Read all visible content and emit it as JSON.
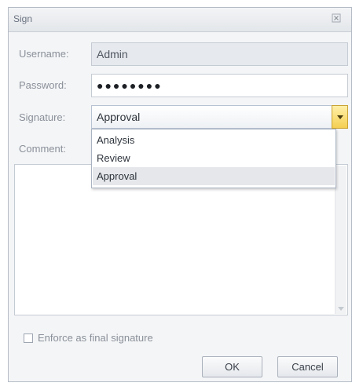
{
  "dialog": {
    "title": "Sign"
  },
  "form": {
    "username_label": "Username:",
    "username_value": "Admin",
    "password_label": "Password:",
    "password_value": "●●●●●●●●",
    "signature_label": "Signature:",
    "signature_value": "Approval",
    "comment_label": "Comment:",
    "comment_value": ""
  },
  "signature_options": [
    {
      "label": "Analysis",
      "selected": false
    },
    {
      "label": "Review",
      "selected": false
    },
    {
      "label": "Approval",
      "selected": true
    }
  ],
  "enforce_checkbox": {
    "label": "Enforce as final signature",
    "checked": false
  },
  "buttons": {
    "ok": "OK",
    "cancel": "Cancel"
  },
  "colors": {
    "accent_button": "#f5cf52",
    "dialog_bg": "#f4f5f7"
  }
}
